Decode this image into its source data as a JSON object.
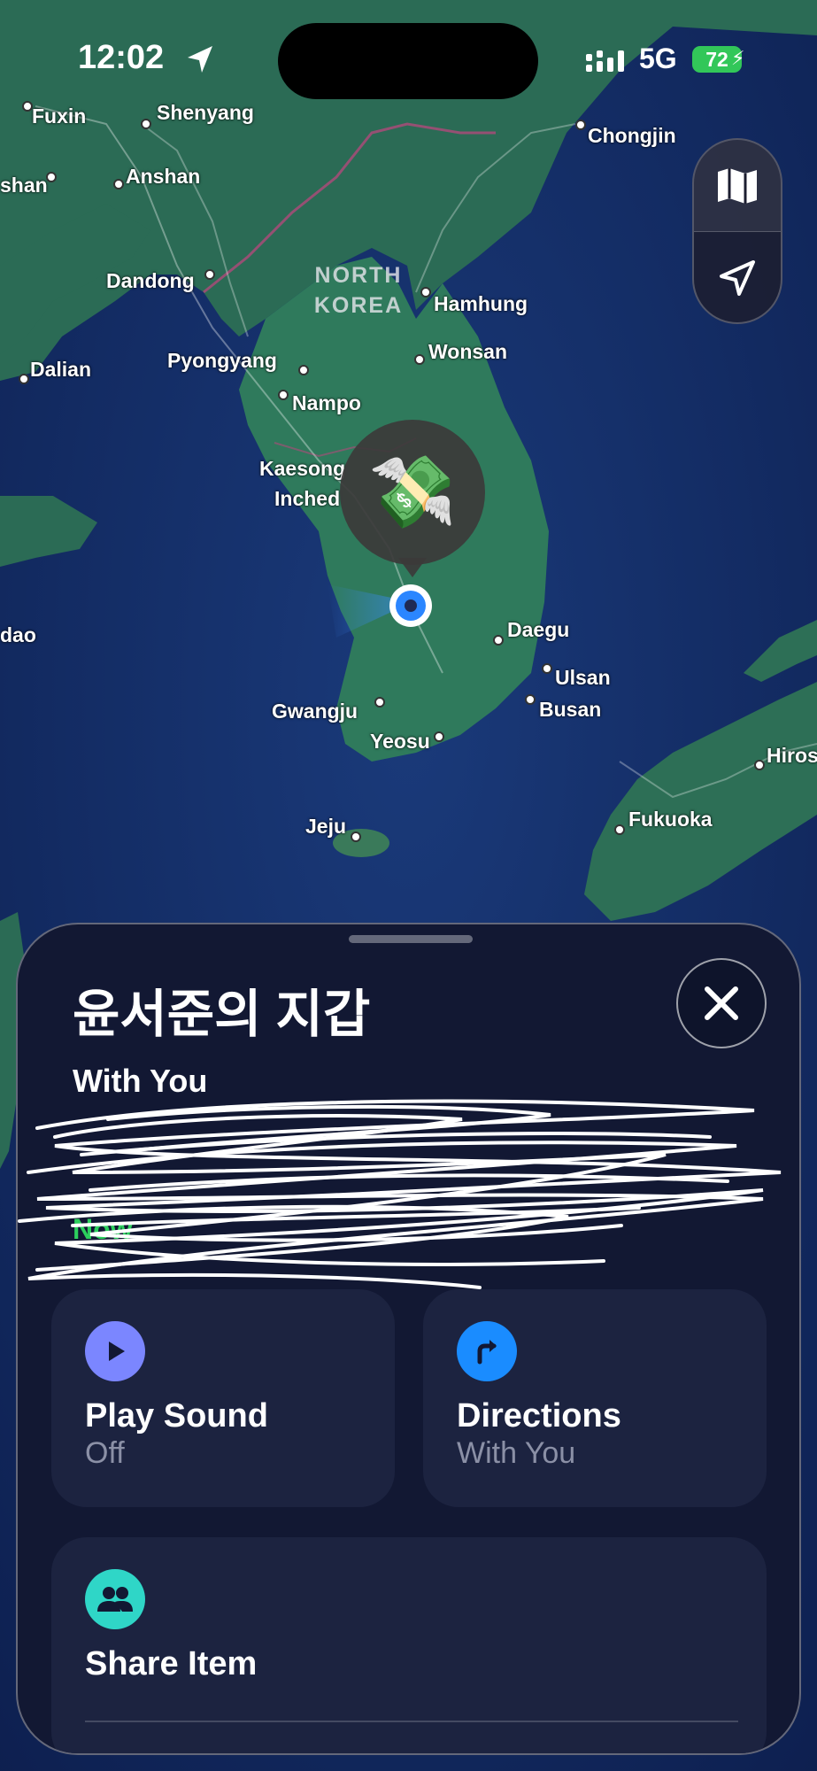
{
  "status_bar": {
    "time": "12:02",
    "network": "5G",
    "battery": "72"
  },
  "map": {
    "country_label": "NORTH KOREA",
    "cities": [
      "Fuxin",
      "Shenyang",
      "shan",
      "Anshan",
      "Chongjin",
      "Dandong",
      "Hamhung",
      "Dalian",
      "Pyongyang",
      "Wonsan",
      "Nampo",
      "Kaesong",
      "Inched",
      "dao",
      "Daegu",
      "Ulsan",
      "Busan",
      "Gwangju",
      "Yeosu",
      "Jeju",
      "Fukuoka",
      "Hiros"
    ]
  },
  "item": {
    "title": "윤서준의 지갑",
    "status": "With You",
    "updated": "Now",
    "emoji": "💸"
  },
  "actions": {
    "play_sound": {
      "label": "Play Sound",
      "sub": "Off"
    },
    "directions": {
      "label": "Directions",
      "sub": "With You"
    },
    "share_item": {
      "label": "Share Item"
    }
  },
  "colors": {
    "ocean": "#0f2356",
    "land": "#2b6b55",
    "sheet": "#121833",
    "card": "#1c2340",
    "play_icon": "#7b86ff",
    "directions_icon": "#1a8cff",
    "share_icon": "#2fd6c7",
    "battery": "#32c759",
    "updated": "#2ccf5d"
  }
}
